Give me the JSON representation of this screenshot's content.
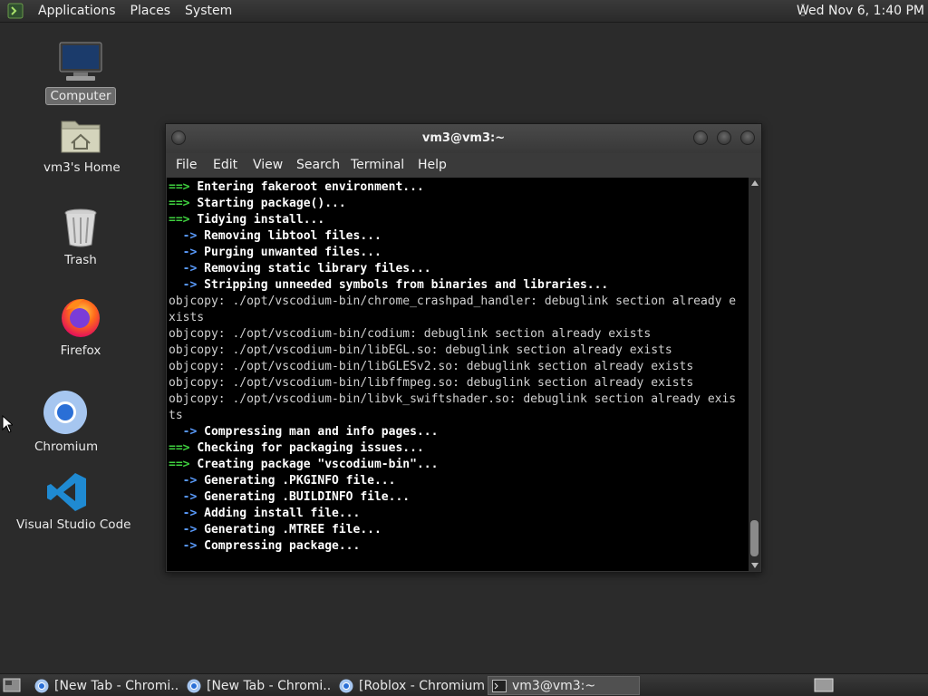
{
  "top_panel": {
    "menus": [
      "Applications",
      "Places",
      "System"
    ],
    "clock": "Wed Nov  6,  1:40 PM"
  },
  "desktop": {
    "icons": [
      {
        "label": "Computer",
        "icon": "computer-icon",
        "selected": true
      },
      {
        "label": "vm3's Home",
        "icon": "home-folder-icon"
      },
      {
        "label": "Trash",
        "icon": "trash-icon"
      },
      {
        "label": "Firefox",
        "icon": "firefox-icon"
      },
      {
        "label": "Chromium",
        "icon": "chromium-icon"
      },
      {
        "label": "Visual Studio Code",
        "icon": "vscode-icon"
      }
    ]
  },
  "terminal": {
    "title": "vm3@vm3:~",
    "menu": [
      "File",
      "Edit",
      "View",
      "Search",
      "Terminal",
      "Help"
    ],
    "lines": [
      {
        "prefix": "==> ",
        "kind": "g",
        "text": "Entering fakeroot environment..."
      },
      {
        "prefix": "==> ",
        "kind": "g",
        "text": "Starting package()..."
      },
      {
        "prefix": "==> ",
        "kind": "g",
        "text": "Tidying install..."
      },
      {
        "prefix": "  -> ",
        "kind": "bl",
        "text": "Removing libtool files..."
      },
      {
        "prefix": "  -> ",
        "kind": "bl",
        "text": "Purging unwanted files..."
      },
      {
        "prefix": "  -> ",
        "kind": "bl",
        "text": "Removing static library files..."
      },
      {
        "prefix": "  -> ",
        "kind": "bl",
        "text": "Stripping unneeded symbols from binaries and libraries..."
      },
      {
        "prefix": "",
        "kind": "plain",
        "text": "objcopy: ./opt/vscodium-bin/chrome_crashpad_handler: debuglink section already e"
      },
      {
        "prefix": "",
        "kind": "plain",
        "text": "xists"
      },
      {
        "prefix": "",
        "kind": "plain",
        "text": "objcopy: ./opt/vscodium-bin/codium: debuglink section already exists"
      },
      {
        "prefix": "",
        "kind": "plain",
        "text": "objcopy: ./opt/vscodium-bin/libEGL.so: debuglink section already exists"
      },
      {
        "prefix": "",
        "kind": "plain",
        "text": "objcopy: ./opt/vscodium-bin/libGLESv2.so: debuglink section already exists"
      },
      {
        "prefix": "",
        "kind": "plain",
        "text": "objcopy: ./opt/vscodium-bin/libffmpeg.so: debuglink section already exists"
      },
      {
        "prefix": "",
        "kind": "plain",
        "text": "objcopy: ./opt/vscodium-bin/libvk_swiftshader.so: debuglink section already exis"
      },
      {
        "prefix": "",
        "kind": "plain",
        "text": "ts"
      },
      {
        "prefix": "  -> ",
        "kind": "bl",
        "text": "Compressing man and info pages..."
      },
      {
        "prefix": "==> ",
        "kind": "g",
        "text": "Checking for packaging issues..."
      },
      {
        "prefix": "==> ",
        "kind": "g",
        "text": "Creating package \"vscodium-bin\"..."
      },
      {
        "prefix": "  -> ",
        "kind": "bl",
        "text": "Generating .PKGINFO file..."
      },
      {
        "prefix": "  -> ",
        "kind": "bl",
        "text": "Generating .BUILDINFO file..."
      },
      {
        "prefix": "  -> ",
        "kind": "bl",
        "text": "Adding install file..."
      },
      {
        "prefix": "  -> ",
        "kind": "bl",
        "text": "Generating .MTREE file..."
      },
      {
        "prefix": "  -> ",
        "kind": "bl",
        "text": "Compressing package..."
      }
    ]
  },
  "taskbar": {
    "tasks": [
      {
        "label": "[New Tab - Chromi...",
        "icon": "chromium-icon",
        "active": false
      },
      {
        "label": "[New Tab - Chromi...",
        "icon": "chromium-icon",
        "active": false
      },
      {
        "label": "[Roblox - Chromium]",
        "icon": "chromium-icon",
        "active": false
      },
      {
        "label": "vm3@vm3:~",
        "icon": "terminal-icon",
        "active": true
      }
    ]
  }
}
